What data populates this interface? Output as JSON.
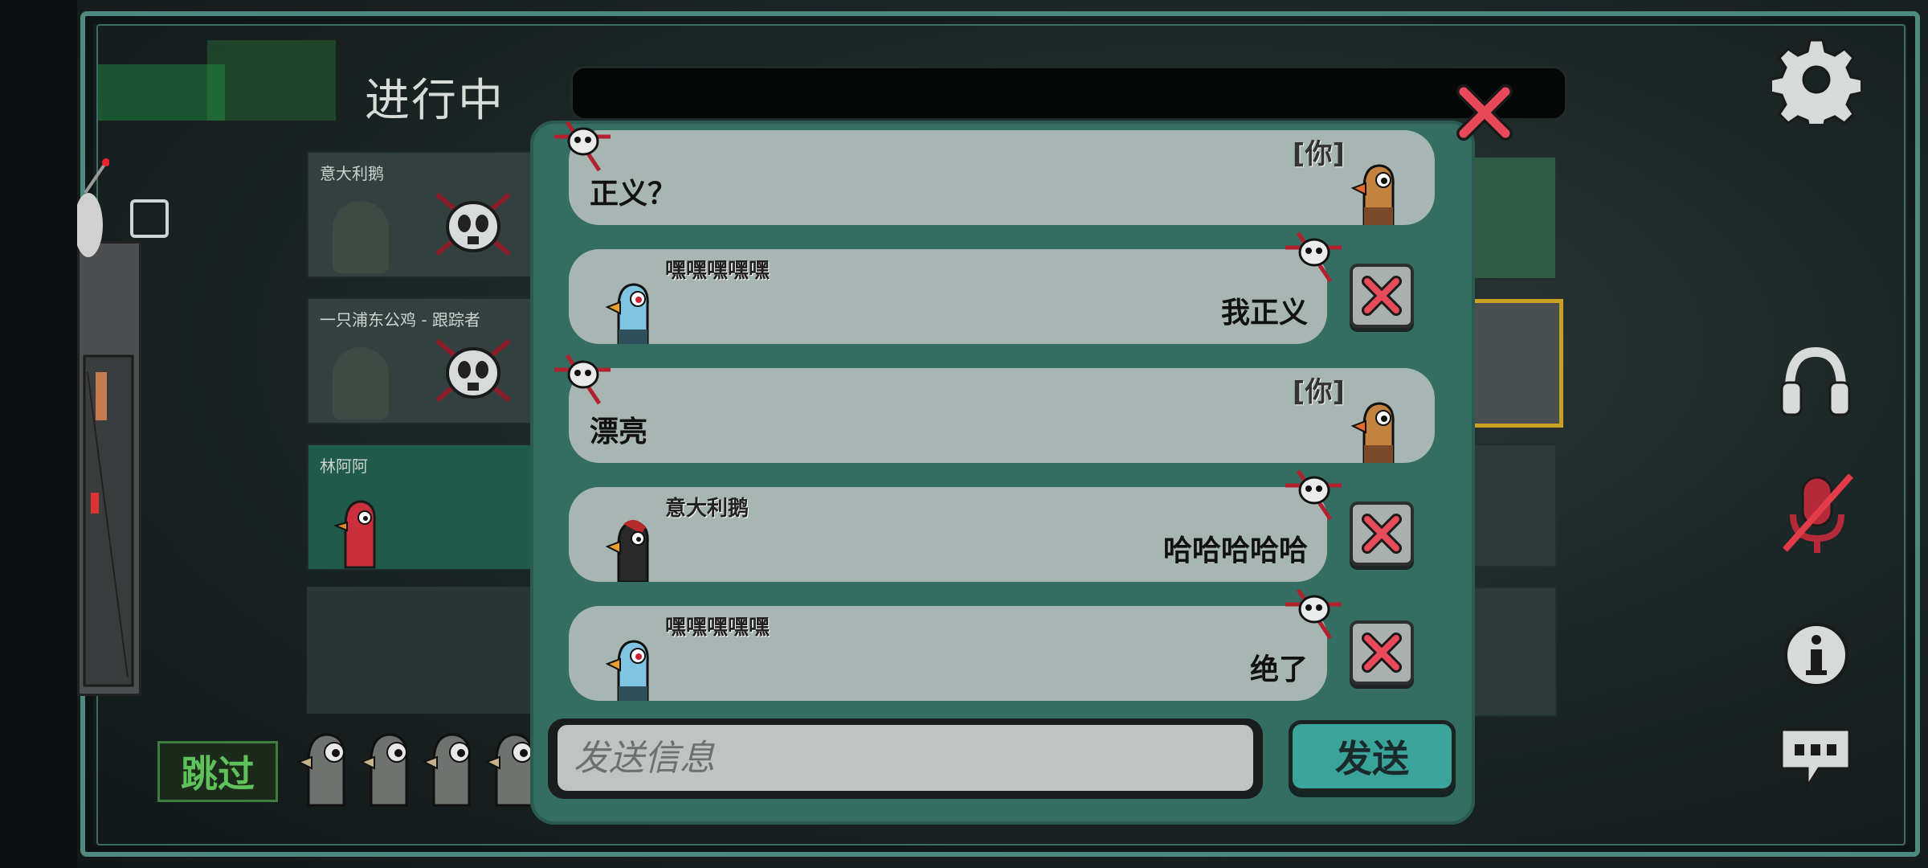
{
  "header": {
    "status_title": "进行中"
  },
  "players": [
    {
      "name": "意大利鹅",
      "dead": true
    },
    {
      "name": "一只浦东公鸡 - 跟踪者",
      "dead": true
    },
    {
      "name": "林阿阿",
      "dead": false
    }
  ],
  "vote": {
    "skip_label": "跳过"
  },
  "chat": {
    "messages": [
      {
        "author": "",
        "text": "正义？",
        "self": true,
        "you_tag": "[你]"
      },
      {
        "author": "嘿嘿嘿嘿嘿",
        "text": "我正义",
        "self": false
      },
      {
        "author": "",
        "text": "漂亮",
        "self": true,
        "you_tag": "[你]"
      },
      {
        "author": "意大利鹅",
        "text": "哈哈哈哈哈",
        "self": false
      },
      {
        "author": "嘿嘿嘿嘿嘿",
        "text": "绝了",
        "self": false
      }
    ],
    "input_placeholder": "发送信息",
    "send_label": "发送"
  },
  "side_icons": [
    "gear-icon",
    "headphones-icon",
    "muted-mic-icon",
    "info-icon",
    "chat-bubble-icon"
  ],
  "colors": {
    "modal": "#346d62",
    "bubble": "#a8b6b3",
    "send": "#3aa39a",
    "close": "#e84a5a",
    "skip": "#5fc15a"
  }
}
